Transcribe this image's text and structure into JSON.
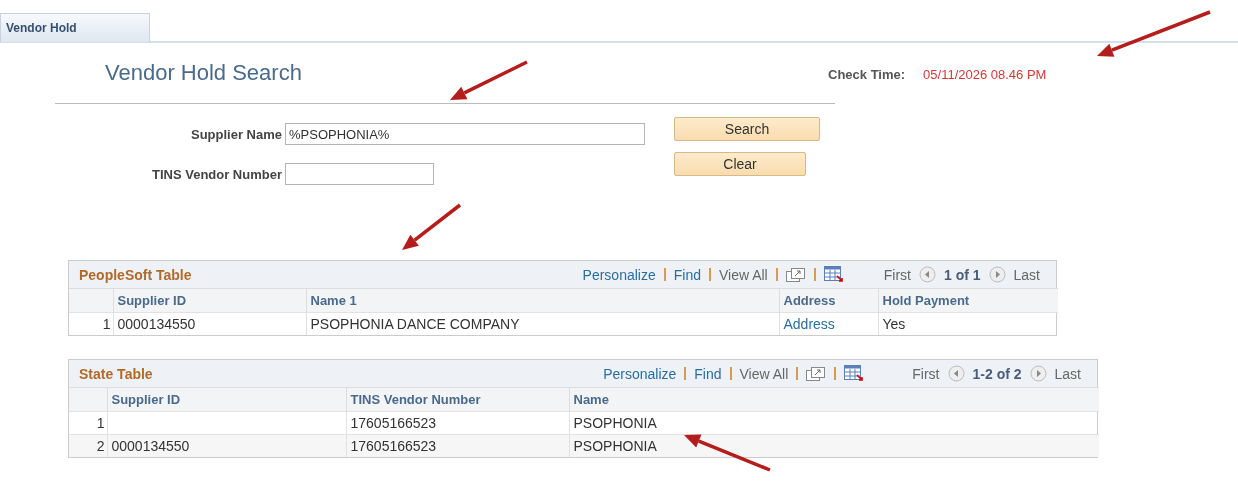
{
  "tabs": [
    {
      "label": "Vendor Hold",
      "selected": true
    }
  ],
  "page_title": "Vendor Hold Search",
  "check_time": {
    "label": "Check Time:",
    "value": "05/11/2026 08.46 PM"
  },
  "fields": [
    {
      "label": "Supplier Name",
      "value": "%PSOPHONIA%"
    },
    {
      "label": "TINS Vendor Number"
    }
  ],
  "buttons": [
    "Search",
    "Clear"
  ],
  "grids": [
    {
      "title": "PeopleSoft Table",
      "links": [
        "Personalize",
        "Find"
      ],
      "view_all": "View All",
      "first": "First",
      "range": "1 of 1",
      "last": "Last",
      "columns": [
        "Supplier ID",
        "Name 1",
        "Address",
        "Hold Payment"
      ],
      "rows": [
        {
          "number": "1",
          "cells": [
            {
              "kind": "text",
              "text": "0000134550"
            },
            {
              "kind": "text",
              "text": "PSOPHONIA DANCE COMPANY"
            },
            {
              "kind": "link",
              "text": "Address"
            },
            {
              "kind": "text",
              "text": "Yes"
            }
          ]
        }
      ]
    },
    {
      "title": "State Table",
      "links": [
        "Personalize",
        "Find"
      ],
      "view_all": "View All",
      "first": "First",
      "range": "1-2 of 2",
      "last": "Last",
      "columns": [
        "Supplier ID",
        "TINS Vendor Number",
        "Name"
      ],
      "rows": [
        {
          "number": "1",
          "cells": [
            {
              "kind": "empty"
            },
            {
              "kind": "text",
              "text": "17605166523"
            },
            {
              "kind": "text",
              "text": "PSOPHONIA"
            }
          ]
        },
        {
          "number": "2",
          "cells": [
            {
              "kind": "text",
              "text": "0000134550"
            },
            {
              "kind": "text",
              "text": "17605166523"
            },
            {
              "kind": "text",
              "text": "PSOPHONIA"
            }
          ]
        }
      ]
    }
  ]
}
